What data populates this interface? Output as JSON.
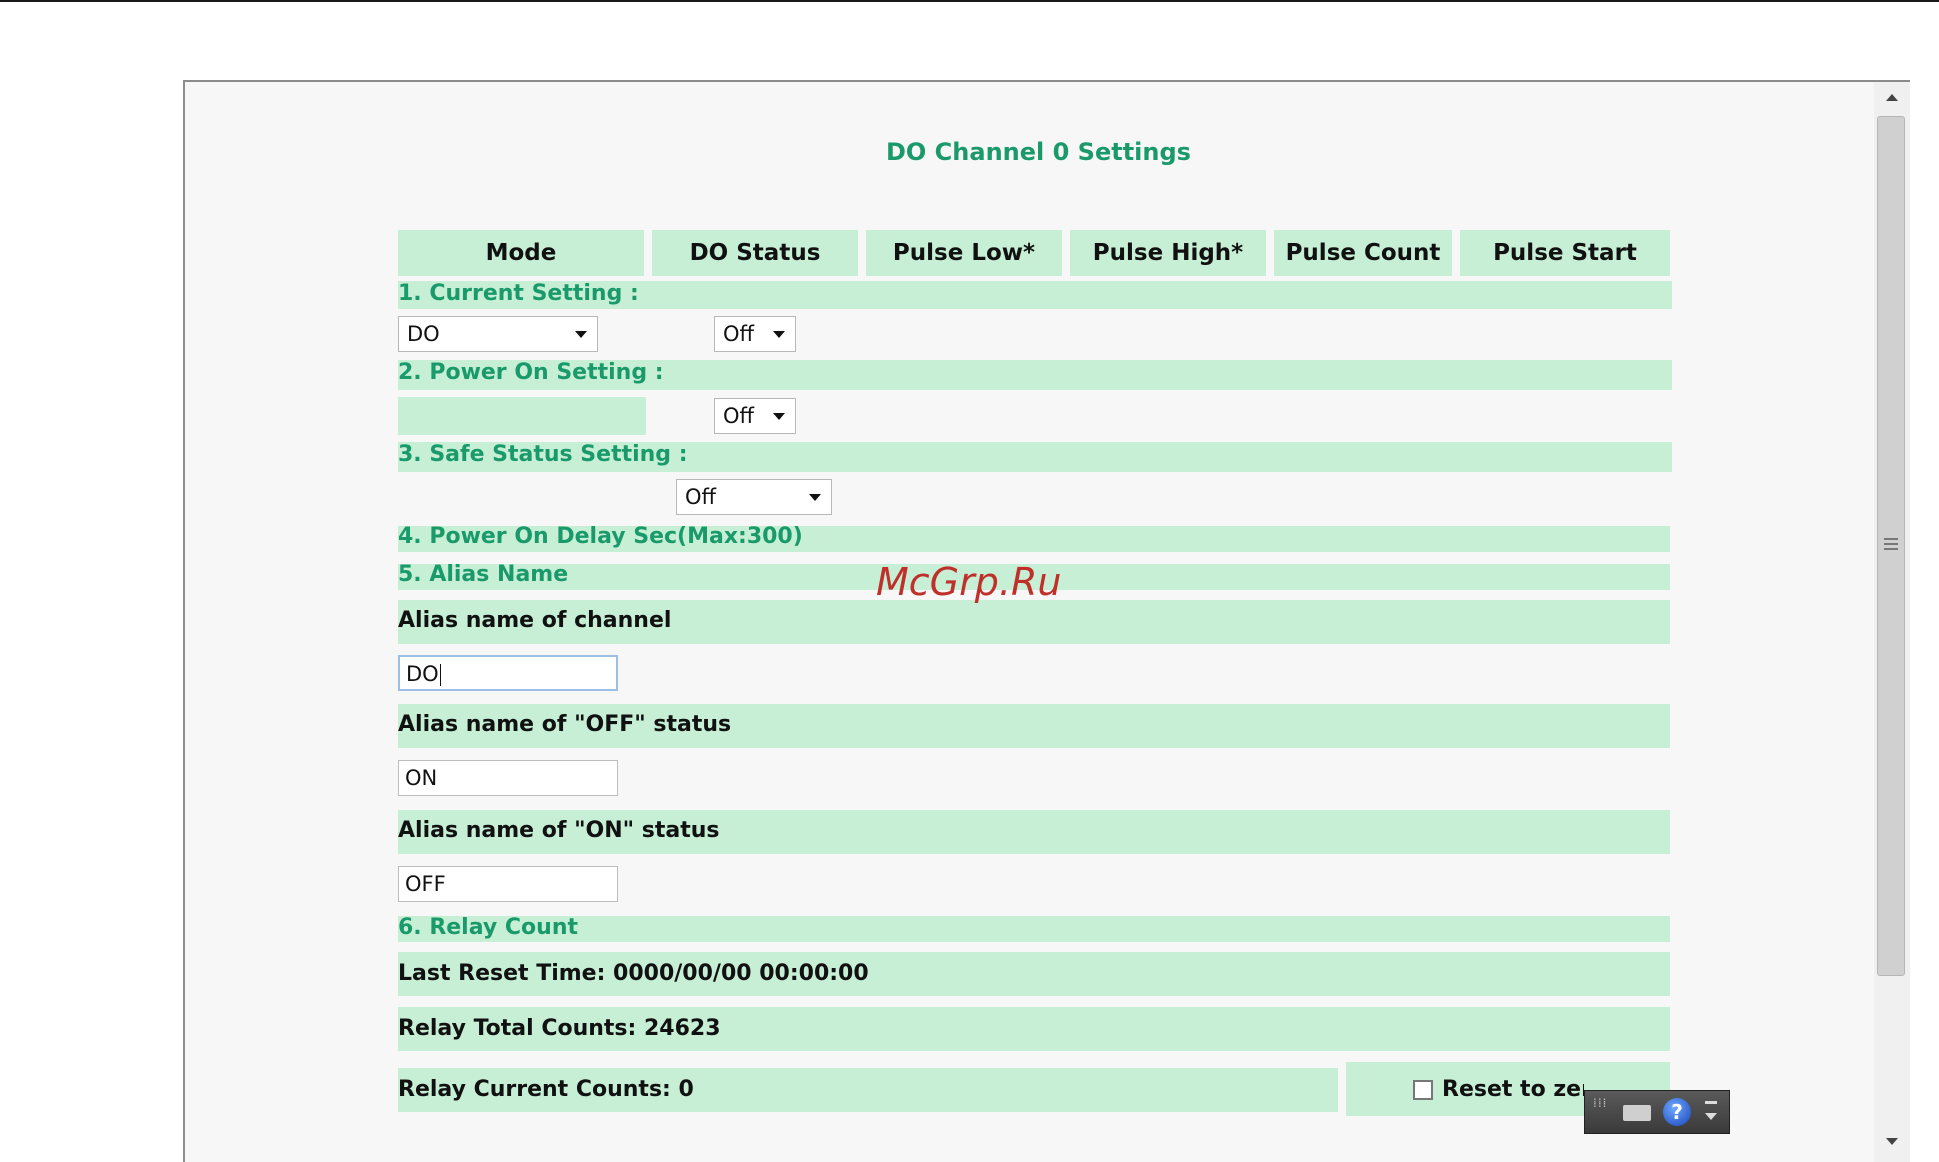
{
  "page": {
    "title": "DO Channel 0 Settings",
    "watermark": "McGrp.Ru"
  },
  "columns": [
    "Mode",
    "DO Status",
    "Pulse Low*",
    "Pulse High*",
    "Pulse Count",
    "Pulse Start"
  ],
  "sections": {
    "current": "1. Current Setting :",
    "power_on": "2. Power On Setting :",
    "safe": "3. Safe Status Setting :",
    "delay": "4. Power On Delay  Sec(Max:300)",
    "alias": "5. Alias Name",
    "relay": "6. Relay Count"
  },
  "current_setting": {
    "mode": "DO",
    "do_status": "Off"
  },
  "power_on_setting": {
    "do_status": "Off"
  },
  "safe_status_setting": {
    "value": "Off"
  },
  "alias": {
    "channel_label": "Alias name of  channel",
    "channel_value": "DO",
    "off_label": "Alias name of \"OFF\" status",
    "off_value": "ON",
    "on_label": "Alias name of \"ON\" status",
    "on_value": "OFF"
  },
  "relay": {
    "last_reset": "Last Reset Time: 0000/00/00 00:00:00",
    "total": "Relay Total Counts: 24623",
    "current": "Relay Current Counts: 0",
    "reset_label": "Reset to zero"
  },
  "toolbar": {
    "help_glyph": "?"
  },
  "colors": {
    "accent_text": "#1a9a6a",
    "band": "#c6efd6"
  }
}
